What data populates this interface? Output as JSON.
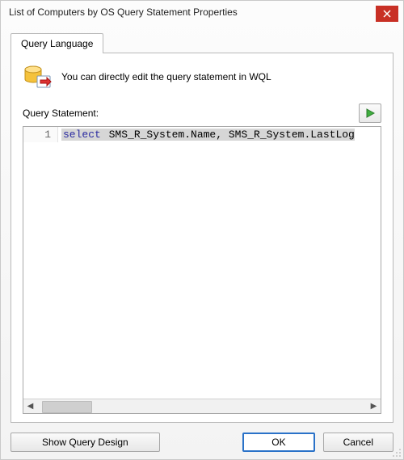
{
  "window": {
    "title": "List of Computers by OS Query Statement Properties"
  },
  "tabs": [
    {
      "label": "Query Language"
    }
  ],
  "hint": {
    "icon": "database-export-icon",
    "text": "You can directly edit the query statement in WQL"
  },
  "statement": {
    "label": "Query Statement:",
    "line_number": "1",
    "keyword": "select",
    "rest": " SMS_R_System.Name, SMS_R_System.LastLog"
  },
  "buttons": {
    "show_design": "Show Query Design",
    "ok": "OK",
    "cancel": "Cancel"
  },
  "scroll": {
    "left_arrow": "◀",
    "right_arrow": "▶"
  }
}
